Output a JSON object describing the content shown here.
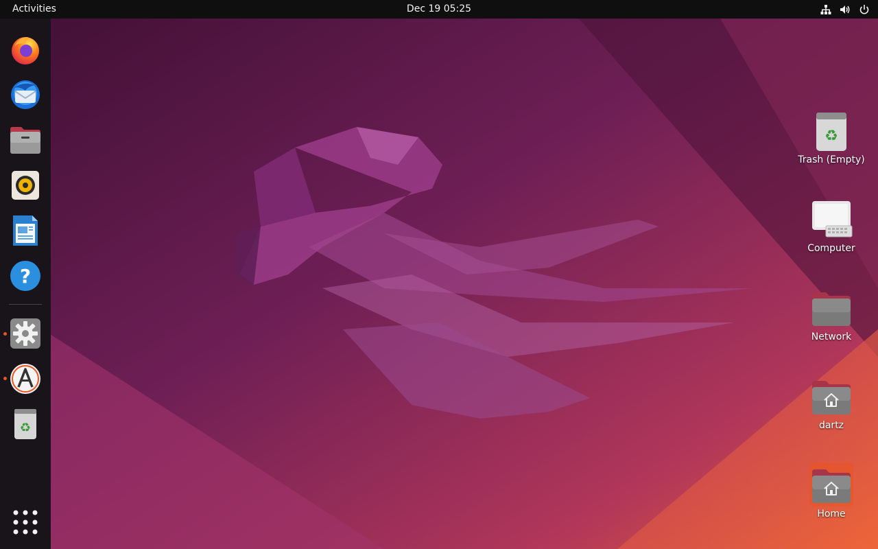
{
  "topbar": {
    "activities_label": "Activities",
    "clock": "Dec 19  05:25",
    "tray": [
      "network-icon",
      "volume-icon",
      "power-icon"
    ]
  },
  "dock": {
    "items": [
      {
        "name": "firefox",
        "icon": "firefox-icon",
        "running": false
      },
      {
        "name": "thunderbird",
        "icon": "thunderbird-icon",
        "running": false
      },
      {
        "name": "files",
        "icon": "files-icon",
        "running": false
      },
      {
        "name": "rhythmbox",
        "icon": "rhythmbox-icon",
        "running": false
      },
      {
        "name": "libreoffice-writer",
        "icon": "writer-icon",
        "running": false
      },
      {
        "name": "help",
        "icon": "help-icon",
        "running": false
      },
      {
        "name": "settings",
        "icon": "settings-icon",
        "running": true
      },
      {
        "name": "software",
        "icon": "software-icon",
        "running": true
      },
      {
        "name": "trash",
        "icon": "trash-icon",
        "running": false
      },
      {
        "name": "show-applications",
        "icon": "app-grid-icon",
        "running": false
      }
    ],
    "accent_color": "#e95420"
  },
  "desktop": {
    "icons": [
      {
        "label": "Trash (Empty)",
        "icon": "trash-icon"
      },
      {
        "label": "Computer",
        "icon": "computer-icon"
      },
      {
        "label": "Network",
        "icon": "network-folder-icon"
      },
      {
        "label": "dartz",
        "icon": "home-folder-icon"
      },
      {
        "label": "Home",
        "icon": "home-folder-icon",
        "selected": true
      }
    ]
  }
}
